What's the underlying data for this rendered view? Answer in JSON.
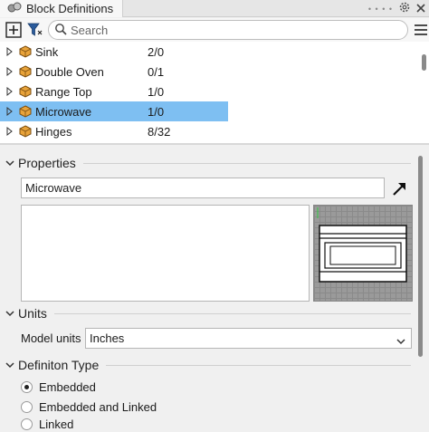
{
  "panel": {
    "tab_title": "Block Definitions"
  },
  "toolbar": {
    "search_placeholder": "Search"
  },
  "blocks": [
    {
      "name": "Sink",
      "count": "2/0",
      "selected": false
    },
    {
      "name": "Double Oven",
      "count": "0/1",
      "selected": false
    },
    {
      "name": "Range Top",
      "count": "1/0",
      "selected": false
    },
    {
      "name": "Microwave",
      "count": "1/0",
      "selected": true
    },
    {
      "name": "Hinges",
      "count": "8/32",
      "selected": false
    }
  ],
  "properties": {
    "section_title": "Properties",
    "name_value": "Microwave",
    "description_value": ""
  },
  "units": {
    "section_title": "Units",
    "model_units_label": "Model units",
    "model_units_value": "Inches"
  },
  "definition_type": {
    "section_title": "Definiton Type",
    "options": [
      {
        "label": "Embedded",
        "checked": true
      },
      {
        "label": "Embedded and Linked",
        "checked": false
      },
      {
        "label": "Linked",
        "checked": false
      }
    ]
  },
  "colors": {
    "selection": "#7ebff2",
    "panel_bg": "#f0f0f0",
    "block_icon": "#e8a33a"
  }
}
